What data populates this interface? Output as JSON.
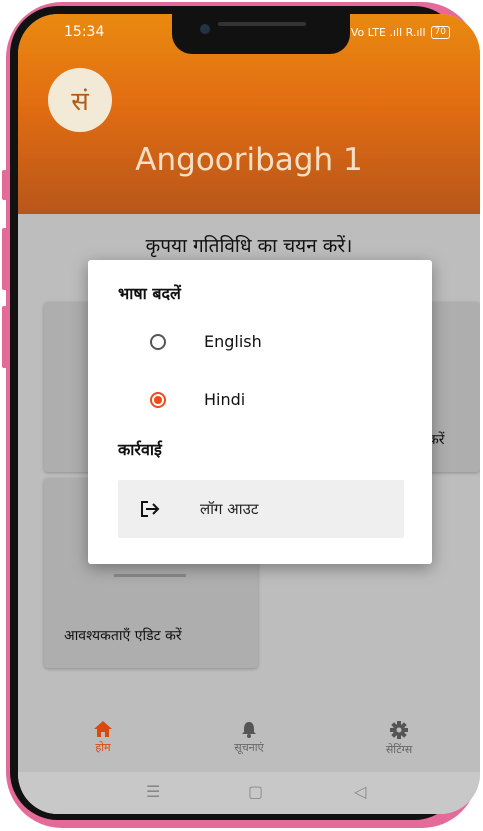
{
  "status": {
    "time": "15:34",
    "signal": "Vo LTE .ıll R.ıll",
    "battery": "70"
  },
  "header": {
    "logo_text": "सं",
    "title": "Angooribagh 1"
  },
  "main": {
    "prompt": "कृपया गतिविधि का चयन करें।",
    "card_right_text": "करें",
    "card_edit_needs": "आवश्यकताएँ एडिट करें"
  },
  "dialog": {
    "language_title": "भाषा बदलें",
    "options": [
      {
        "label": "English",
        "selected": false
      },
      {
        "label": "Hindi",
        "selected": true
      }
    ],
    "action_title": "कार्रवाई",
    "logout_label": "लॉग आउट"
  },
  "bottom_nav": {
    "items": [
      {
        "label": "होम",
        "icon": "home-icon",
        "active": true
      },
      {
        "label": "सूचनाएं",
        "icon": "bell-icon",
        "active": false
      },
      {
        "label": "सेटिंग्स",
        "icon": "gear-icon",
        "active": false
      }
    ]
  },
  "colors": {
    "accent": "#f04a1a",
    "header": "#e26d12",
    "nav_active": "#d94a12"
  }
}
